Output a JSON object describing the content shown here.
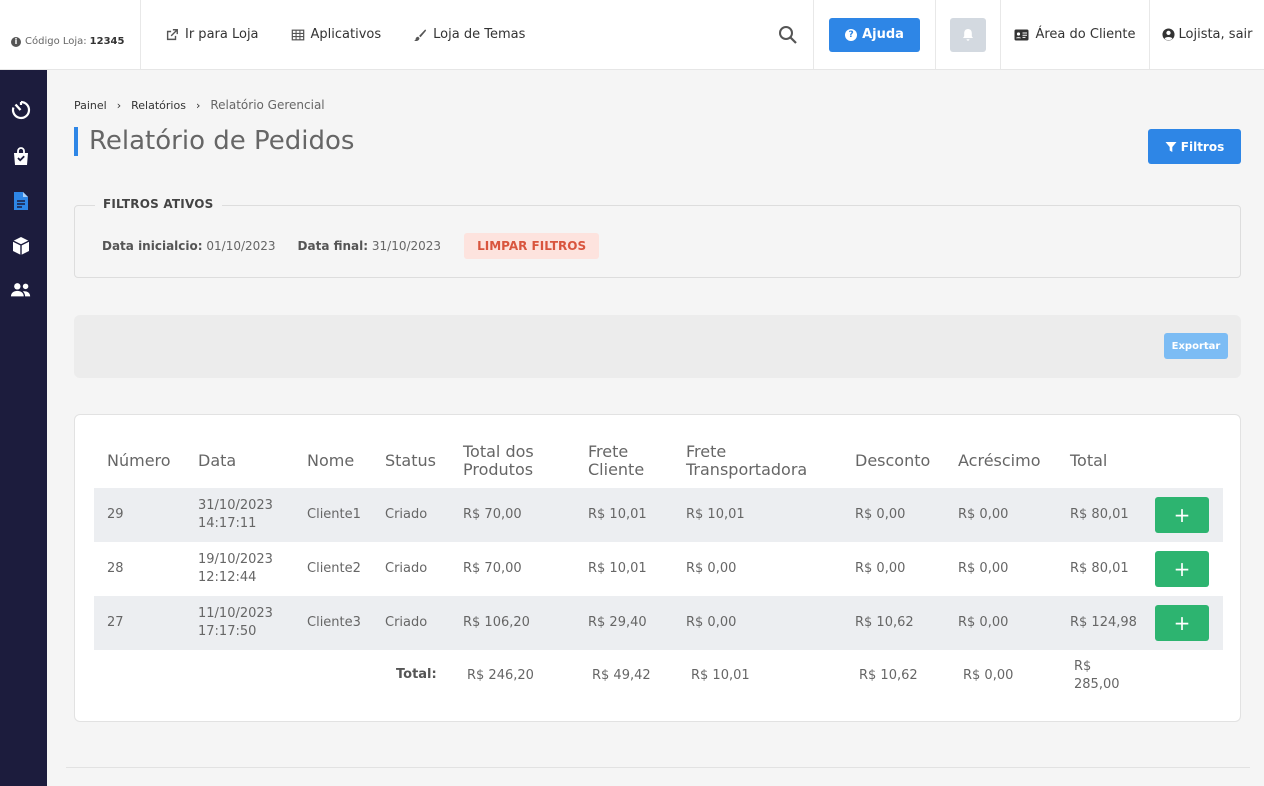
{
  "header": {
    "store_code_label": "Código Loja:",
    "store_code_value": "12345",
    "go_to_store": "Ir para Loja",
    "apps": "Aplicativos",
    "themes": "Loja de Temas",
    "help": "Ajuda",
    "client_area": "Área do Cliente",
    "logout": "Lojista, sair"
  },
  "sidebar": {
    "items": [
      "speed-timer-icon",
      "shopping-bag-icon",
      "document-icon",
      "box-icon",
      "users-icon"
    ],
    "active_item": "document-icon"
  },
  "breadcrumb": {
    "items": [
      "Painel",
      "Relatórios"
    ],
    "current": "Relatório Gerencial"
  },
  "page": {
    "title": "Relatório de Pedidos",
    "filters_button": "Filtros"
  },
  "active_filters": {
    "legend": "FILTROS ATIVOS",
    "start_label": "Data inicialcio:",
    "start_value": "01/10/2023",
    "end_label": "Data final:",
    "end_value": "31/10/2023",
    "clear": "LIMPAR FILTROS"
  },
  "export": {
    "label": "Exportar"
  },
  "table": {
    "columns": [
      "Número",
      "Data",
      "Nome",
      "Status",
      "Total dos Produtos",
      "Frete Cliente",
      "Frete Transportadora",
      "Desconto",
      "Acréscimo",
      "Total"
    ],
    "rows": [
      {
        "numero": "29",
        "data": "31/10/2023",
        "hora": "14:17:11",
        "nome": "Cliente1",
        "status": "Criado",
        "total_produtos": "R$ 70,00",
        "frete_cliente": "R$ 10,01",
        "frete_transportadora": "R$ 10,01",
        "desconto": "R$ 0,00",
        "acrescimo": "R$ 0,00",
        "total": "R$ 80,01",
        "action": "+"
      },
      {
        "numero": "28",
        "data": "19/10/2023",
        "hora": "12:12:44",
        "nome": "Cliente2",
        "status": "Criado",
        "total_produtos": "R$ 70,00",
        "frete_cliente": "R$ 10,01",
        "frete_transportadora": "R$ 0,00",
        "desconto": "R$ 0,00",
        "acrescimo": "R$ 0,00",
        "total": "R$ 80,01",
        "action": "+"
      },
      {
        "numero": "27",
        "data": "11/10/2023",
        "hora": "17:17:50",
        "nome": "Cliente3",
        "status": "Criado",
        "total_produtos": "R$ 106,20",
        "frete_cliente": "R$ 29,40",
        "frete_transportadora": "R$ 0,00",
        "desconto": "R$ 10,62",
        "acrescimo": "R$ 0,00",
        "total": "R$ 124,98",
        "action": "+"
      }
    ],
    "totals": {
      "label": "Total:",
      "total_produtos": "R$ 246,20",
      "frete_cliente": "R$ 49,42",
      "frete_transportadora": "R$ 10,01",
      "desconto": "R$ 10,62",
      "acrescimo": "R$ 0,00",
      "total_currency": "R$",
      "total_value": "285,00"
    }
  },
  "colors": {
    "primary": "#2e86e6",
    "sidebar": "#1c1c3d",
    "success": "#2db470",
    "danger_text": "#d9553e",
    "danger_bg": "#fde3de"
  }
}
